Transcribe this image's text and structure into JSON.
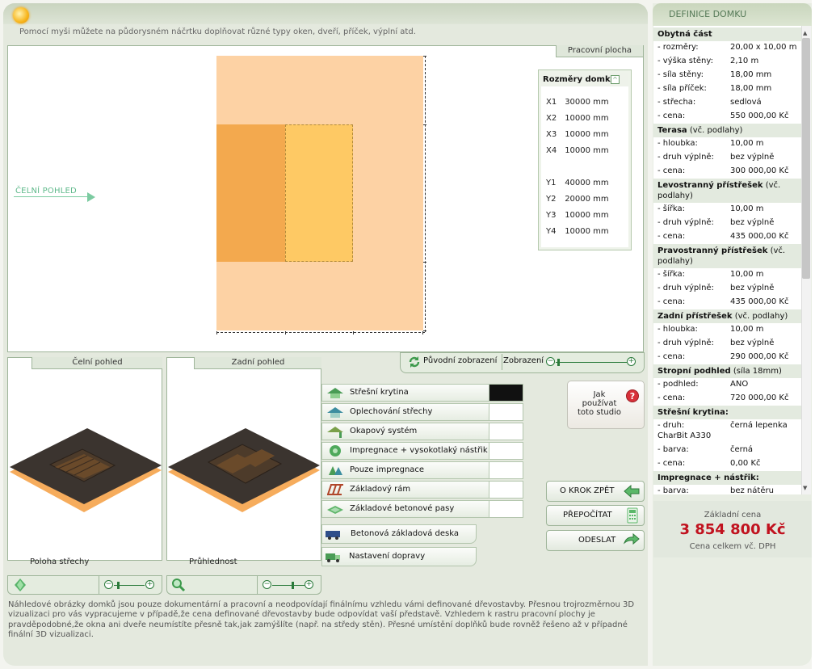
{
  "header": {
    "hint": "Pomocí myši můžete na půdorysném náčrtku doplňovat různé typy oken, dveří, příček, výplní atd."
  },
  "work_area": {
    "tab_label": "Pracovní plocha",
    "front_view_label": "ČELNÍ POHLED",
    "dimensions_box": {
      "title": "Rozměry domku",
      "rows": [
        {
          "key": "X1",
          "value": "30000 mm"
        },
        {
          "key": "X2",
          "value": "10000 mm"
        },
        {
          "key": "X3",
          "value": "10000 mm"
        },
        {
          "key": "X4",
          "value": "10000 mm"
        },
        {
          "key": "Y1",
          "value": "40000 mm"
        },
        {
          "key": "Y2",
          "value": "20000 mm"
        },
        {
          "key": "Y3",
          "value": "10000 mm"
        },
        {
          "key": "Y4",
          "value": "10000 mm"
        }
      ]
    }
  },
  "toolbar": {
    "original_view_label": "Původní zobrazení",
    "zoom_label": "Zobrazení"
  },
  "previews": {
    "front": {
      "title": "Čelní pohled",
      "caption": "Poloha střechy"
    },
    "back": {
      "title": "Zadní pohled",
      "caption": "Průhlednost"
    }
  },
  "options": [
    {
      "label": "Střešní krytina",
      "icon": "roof-icon"
    },
    {
      "label": "Oplechování střechy",
      "icon": "roof-metal-icon"
    },
    {
      "label": "Okapový systém",
      "icon": "gutter-icon"
    },
    {
      "label": "Impregnace + vysokotlaký nástřik",
      "icon": "spray-icon"
    },
    {
      "label": "Pouze impregnace",
      "icon": "impregnation-icon"
    },
    {
      "label": "Základový rám",
      "icon": "frame-icon"
    },
    {
      "label": "Základové betonové pasy",
      "icon": "concrete-strip-icon"
    }
  ],
  "extra_options": [
    {
      "label": "Betonová základová deska",
      "icon": "concrete-slab-icon"
    },
    {
      "label": "Nastavení dopravy",
      "icon": "transport-icon"
    }
  ],
  "help": {
    "label_line1": "Jak",
    "label_line2": "používat",
    "label_line3": "toto studio"
  },
  "nav_buttons": {
    "back": "O KROK ZPĚT",
    "recalc": "PŘEPOČÍTAT",
    "send": "ODESLAT"
  },
  "footer": {
    "text": "Náhledové obrázky domků jsou pouze dokumentární a pracovní a neodpovídají finálnímu vzhledu vámi definované dřevostavby. Přesnou trojrozměrnou 3D vizualizaci pro vás vypracujeme v případě,že cena definované dřevostavby bude odpovídat vaší představě. Vzhledem k rastru pracovní plochy je pravděpodobné,že okna ani dveře neumístíte přesně tak,jak zamýšlíte (např. na středy stěn). Přesné umístění doplňků bude rovněž řešeno až v případné finální 3D vizualizaci."
  },
  "sidebar": {
    "title": "DEFINICE DOMKU",
    "rows": [
      {
        "type": "h",
        "key": "Obytná část",
        "sub": ""
      },
      {
        "type": "d",
        "key": "- rozměry:",
        "value": "20,00 x 10,00 m"
      },
      {
        "type": "d",
        "key": "- výška stěny:",
        "value": "2,10 m"
      },
      {
        "type": "d",
        "key": "- síla stěny:",
        "value": "18,00 mm"
      },
      {
        "type": "d",
        "key": "- síla příček:",
        "value": "18,00 mm"
      },
      {
        "type": "d",
        "key": "- střecha:",
        "value": "sedlová"
      },
      {
        "type": "d",
        "key": "- cena:",
        "value": "550 000,00 Kč"
      },
      {
        "type": "h",
        "key": "Terasa",
        "sub": "(vč. podlahy)"
      },
      {
        "type": "d",
        "key": "- hloubka:",
        "value": "10,00 m"
      },
      {
        "type": "d",
        "key": "- druh výplně:",
        "value": "bez výplně"
      },
      {
        "type": "d",
        "key": "- cena:",
        "value": "300 000,00 Kč"
      },
      {
        "type": "h2",
        "key": "Levostranný přístřešek",
        "sub": "(vč.",
        "line2": "podlahy)"
      },
      {
        "type": "d",
        "key": "- šířka:",
        "value": "10,00 m"
      },
      {
        "type": "d",
        "key": "- druh výplně:",
        "value": "bez výplně"
      },
      {
        "type": "d",
        "key": "- cena:",
        "value": "435 000,00 Kč"
      },
      {
        "type": "h2",
        "key": "Pravostranný přístřešek",
        "sub": "(vč.",
        "line2": "podlahy)"
      },
      {
        "type": "d",
        "key": "- šířka:",
        "value": "10,00 m"
      },
      {
        "type": "d",
        "key": "- druh výplně:",
        "value": "bez výplně"
      },
      {
        "type": "d",
        "key": "- cena:",
        "value": "435 000,00 Kč"
      },
      {
        "type": "h",
        "key": "Zadní přístřešek",
        "sub": "(vč. podlahy)"
      },
      {
        "type": "d",
        "key": "- hloubka:",
        "value": "10,00 m"
      },
      {
        "type": "d",
        "key": "- druh výplně:",
        "value": "bez výplně"
      },
      {
        "type": "d",
        "key": "- cena:",
        "value": "290 000,00 Kč"
      },
      {
        "type": "h",
        "key": "Stropní podhled",
        "sub": "(síla 18mm)"
      },
      {
        "type": "d",
        "key": "- podhled:",
        "value": "ANO"
      },
      {
        "type": "d",
        "key": "- cena:",
        "value": "720 000,00 Kč"
      },
      {
        "type": "h",
        "key": "Střešní krytina:",
        "sub": ""
      },
      {
        "type": "d2",
        "key": "- druh:",
        "value": "černá lepenka",
        "line2": "CharBit A330"
      },
      {
        "type": "d",
        "key": "- barva:",
        "value": "černá"
      },
      {
        "type": "d",
        "key": "- cena:",
        "value": "0,00 Kč"
      },
      {
        "type": "h",
        "key": "Impregnace + nástřik:",
        "sub": ""
      },
      {
        "type": "d",
        "key": "- barva:",
        "value": "bez nátěru"
      }
    ],
    "price_label": "Základní cena",
    "price_value": "3 854 800 Kč",
    "price_note": "Cena celkem vč. DPH"
  }
}
